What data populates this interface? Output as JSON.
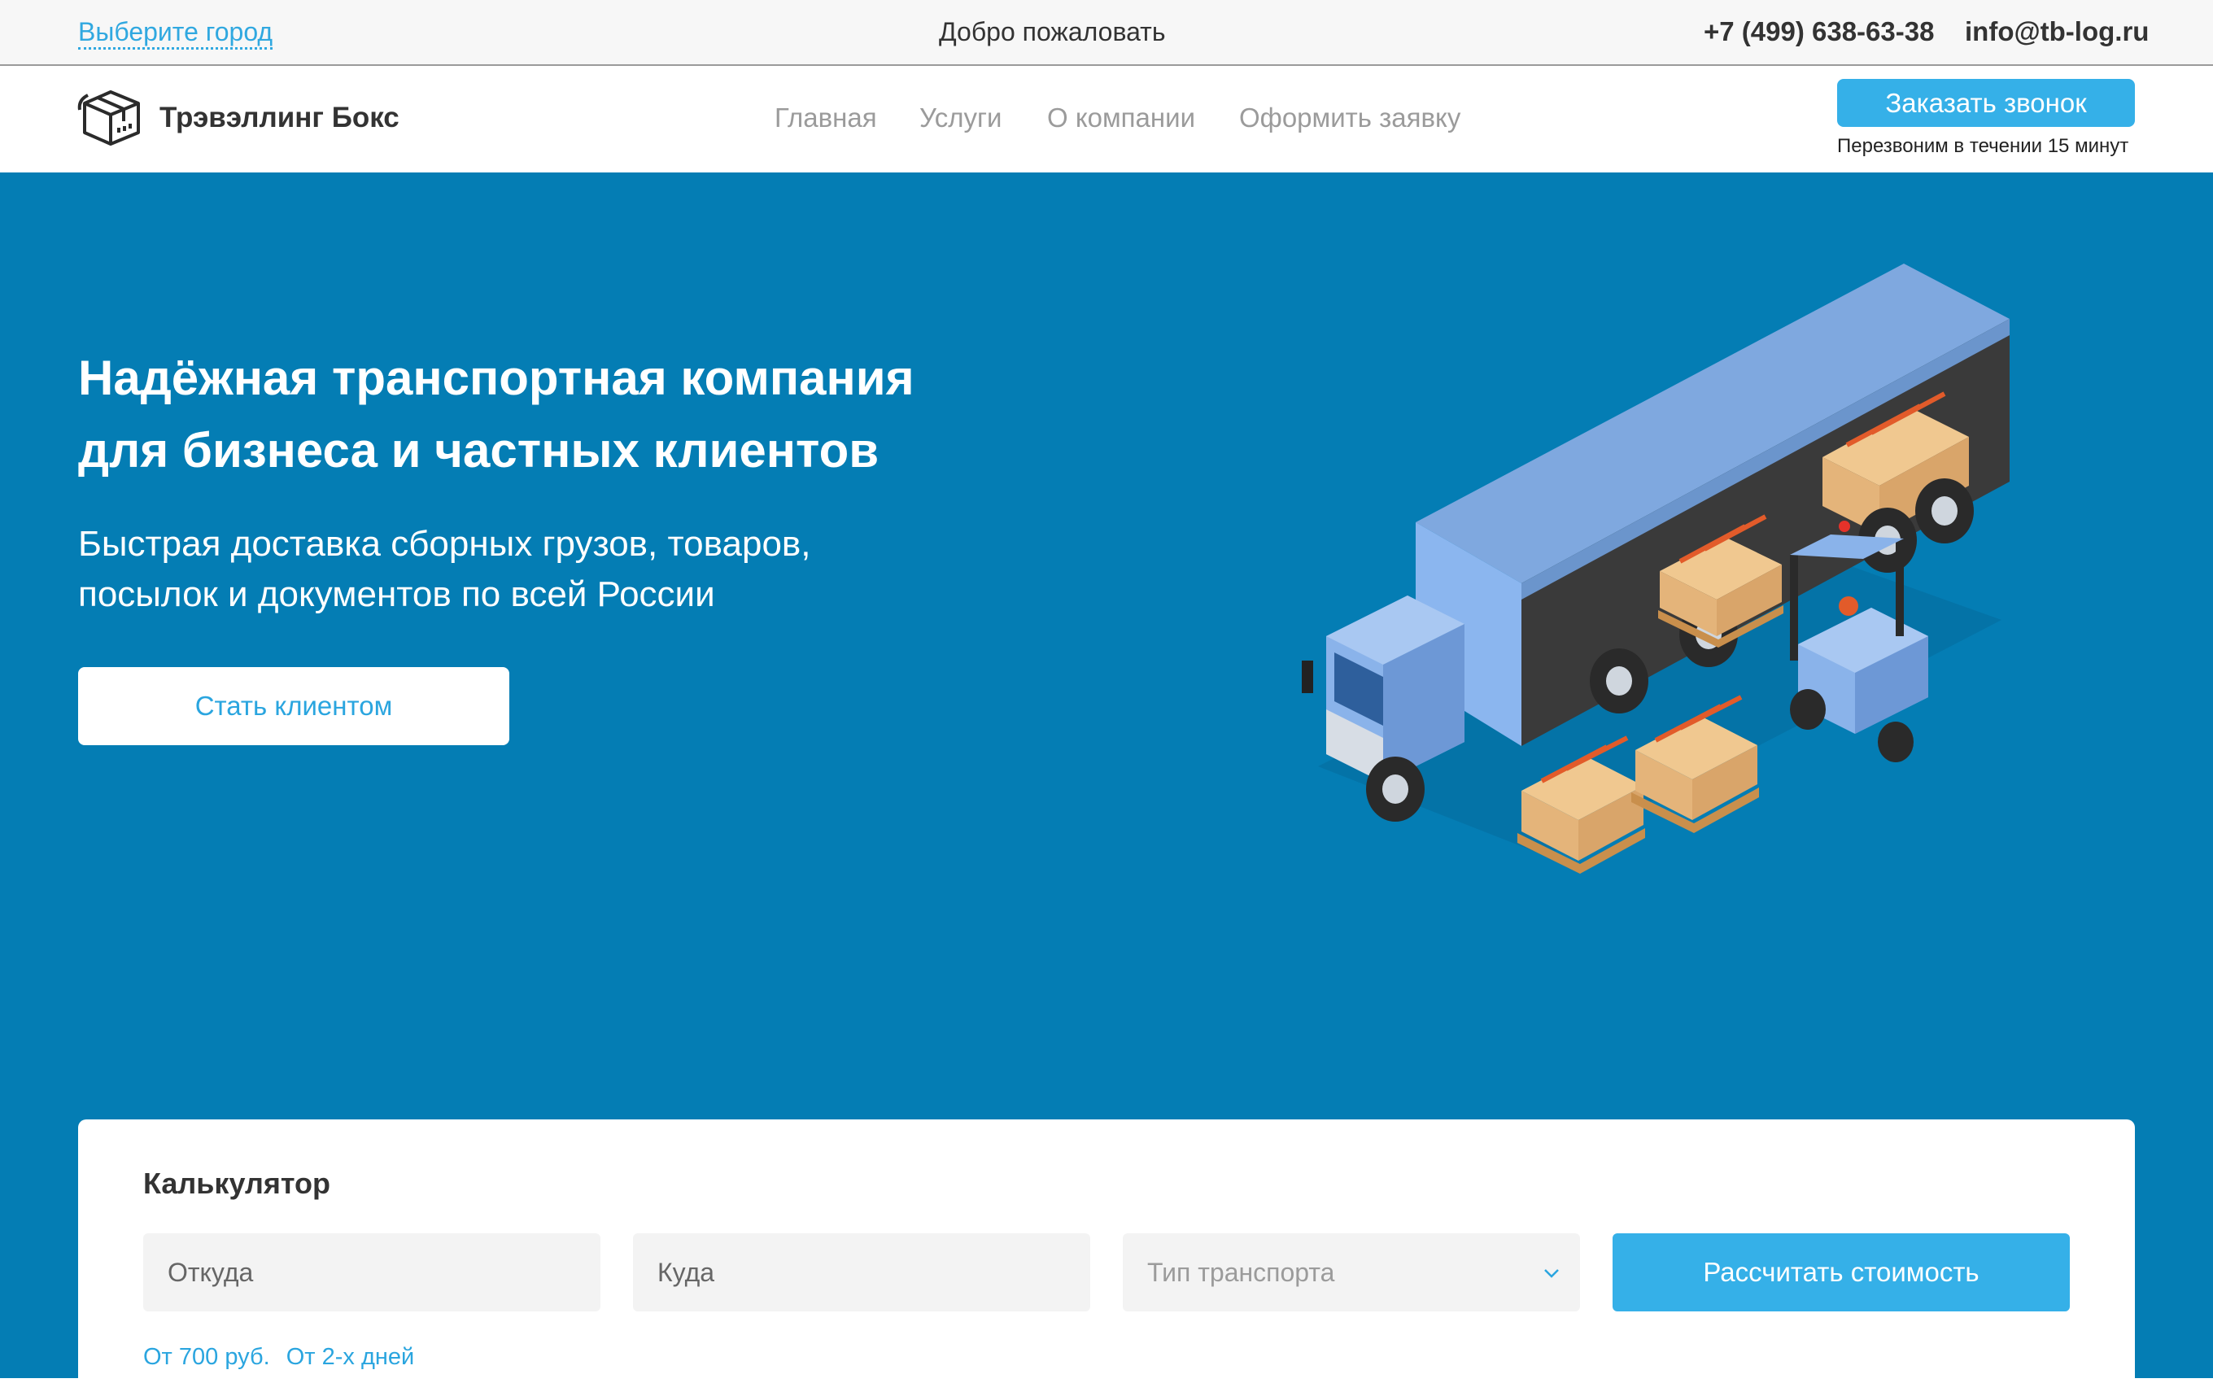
{
  "topbar": {
    "city_link": "Выберите город",
    "welcome": "Добро пожаловать",
    "phone": "+7 (499) 638-63-38",
    "email": "info@tb-log.ru"
  },
  "header": {
    "logo_text": "Трэвэллинг Бокс",
    "nav": {
      "home": "Главная",
      "services": "Услуги",
      "about": "О компании",
      "order": "Оформить заявку"
    },
    "callback_button": "Заказать звонок",
    "callback_note": "Перезвоним в течении 15 минут"
  },
  "hero": {
    "title_line1": "Надёжная транспортная компания",
    "title_line2": "для бизнеса и частных клиентов",
    "subtitle_line1": "Быстрая доставка сборных грузов, товаров,",
    "subtitle_line2": "посылок и документов по всей России",
    "cta_button": "Стать клиентом"
  },
  "calculator": {
    "title": "Калькулятор",
    "from_placeholder": "Откуда",
    "to_placeholder": "Куда",
    "transport_type": "Тип транспорта",
    "submit_button": "Рассчитать стоимость",
    "price_note": "От 700 руб.",
    "time_note": "От 2-х дней"
  },
  "colors": {
    "hero_background": "#047db4",
    "accent": "#35b0e8",
    "link": "#30a8e0"
  },
  "icons": {
    "logo": "box-logo-icon",
    "select": "chevron-down-icon",
    "illustration": "truck-forklift-illustration"
  }
}
